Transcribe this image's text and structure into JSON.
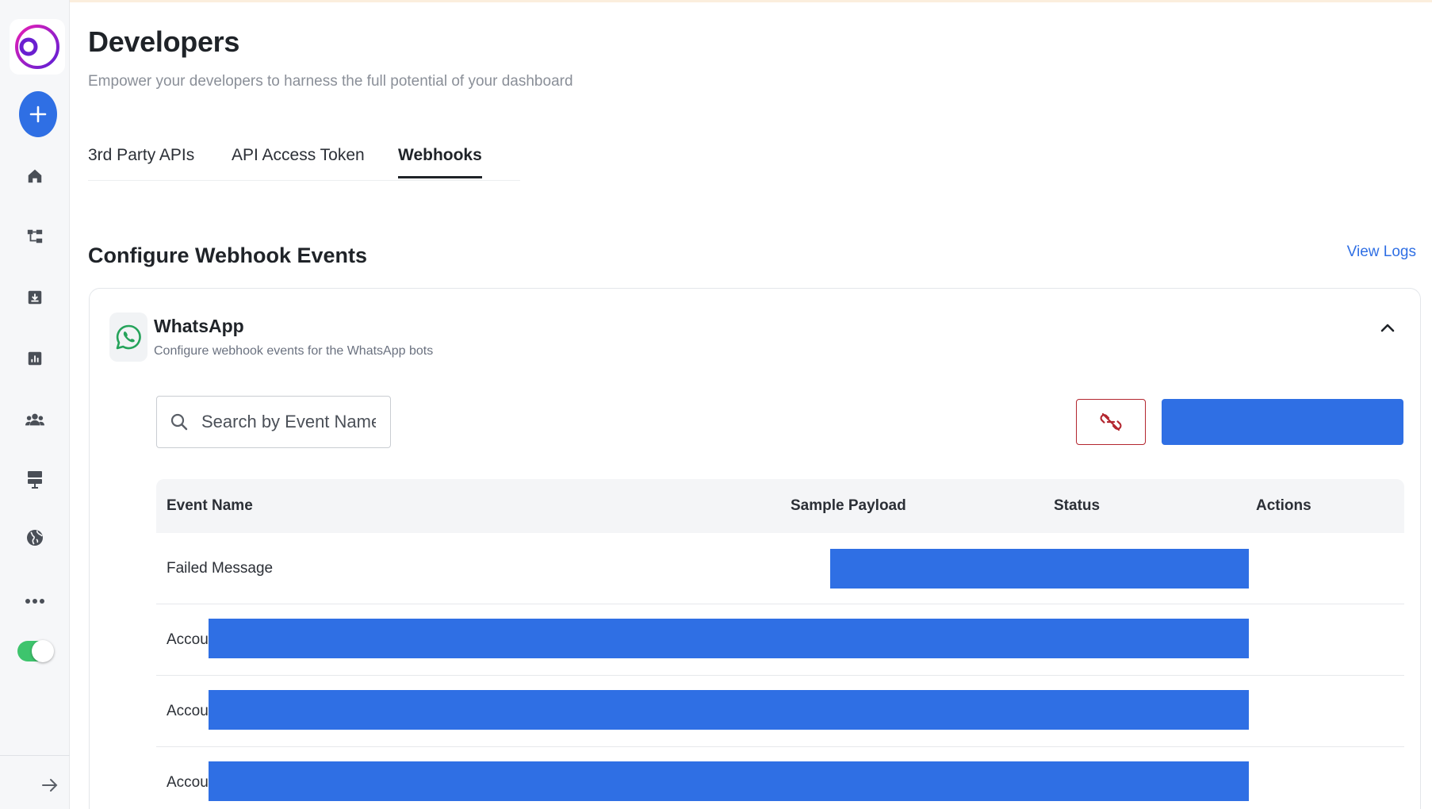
{
  "header": {
    "title": "Developers",
    "subtitle": "Empower your developers to harness the full potential of your dashboard"
  },
  "tabs": [
    {
      "label": "3rd Party APIs",
      "active": false
    },
    {
      "label": "API Access Token",
      "active": false
    },
    {
      "label": "Webhooks",
      "active": true
    }
  ],
  "section": {
    "title": "Configure Webhook Events",
    "view_logs": "View Logs"
  },
  "integration": {
    "name": "WhatsApp",
    "description": "Configure webhook events for the WhatsApp bots",
    "icon": "whatsapp-icon"
  },
  "search": {
    "placeholder": "Search by Event Name",
    "value": ""
  },
  "table": {
    "headers": [
      "Event Name",
      "Sample Payload",
      "Status",
      "Actions"
    ],
    "rows": [
      {
        "event_name": "Failed Message"
      },
      {
        "event_name": "Accour"
      },
      {
        "event_name": "Accour"
      },
      {
        "event_name": "Accour"
      }
    ]
  },
  "sidebar": {
    "toggle_on": true,
    "icons": [
      "home-icon",
      "flow-icon",
      "inbox-icon",
      "analytics-icon",
      "contacts-icon",
      "broadcast-icon",
      "globe-icon",
      "more-icon"
    ]
  },
  "colors": {
    "accent": "#2f6fe4",
    "danger": "#b3262f",
    "whatsapp": "#25a35a",
    "toggle": "#3ec46d"
  }
}
